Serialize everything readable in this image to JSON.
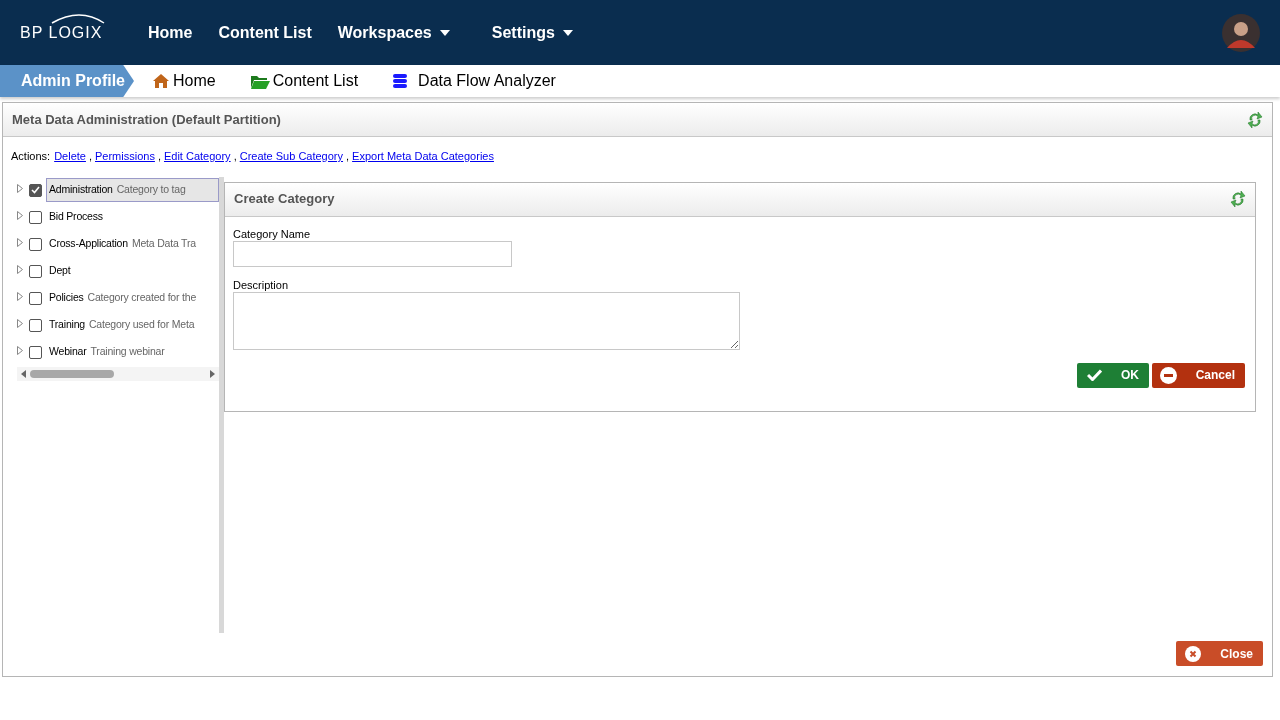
{
  "topbar": {
    "logo": "BP LOGIX",
    "nav": [
      {
        "label": "Home",
        "kind": "link"
      },
      {
        "label": "Content List",
        "kind": "link"
      },
      {
        "label": "Workspaces",
        "kind": "dropdown"
      },
      {
        "label": "Settings",
        "kind": "dropdown"
      }
    ]
  },
  "breadcrumb": {
    "profile": "Admin Profile",
    "links": [
      {
        "label": "Home",
        "kind": "home"
      },
      {
        "label": "Content List",
        "kind": "folder"
      },
      {
        "label": "Data Flow Analyzer",
        "kind": "database"
      }
    ]
  },
  "panel": {
    "title": "Meta Data Administration (Default Partition)",
    "actions_label": "Actions:",
    "actions_separator": ",",
    "actions": [
      "Delete",
      "Permissions",
      "Edit Category",
      "Create Sub Category",
      "Export Meta Data Categories"
    ],
    "tree": [
      {
        "name": "Administration",
        "description": "Category to tag",
        "checked": true,
        "selected": true
      },
      {
        "name": "Bid Process",
        "checked": false,
        "selected": false
      },
      {
        "name": "Cross-Application",
        "description": "Meta Data Tra",
        "checked": false,
        "selected": false
      },
      {
        "name": "Dept",
        "checked": false,
        "selected": false
      },
      {
        "name": "Policies",
        "description": "Category created for the",
        "checked": false,
        "selected": false
      },
      {
        "name": "Training",
        "description": "Category used for Meta",
        "checked": false,
        "selected": false
      },
      {
        "name": "Webinar",
        "description": "Training webinar",
        "checked": false,
        "selected": false
      }
    ],
    "form": {
      "title": "Create Category",
      "fields": [
        {
          "label": "Category Name",
          "kind": "text"
        },
        {
          "label": "Description",
          "kind": "textarea"
        }
      ],
      "ok": "OK",
      "cancel": "Cancel"
    },
    "close": "Close"
  }
}
